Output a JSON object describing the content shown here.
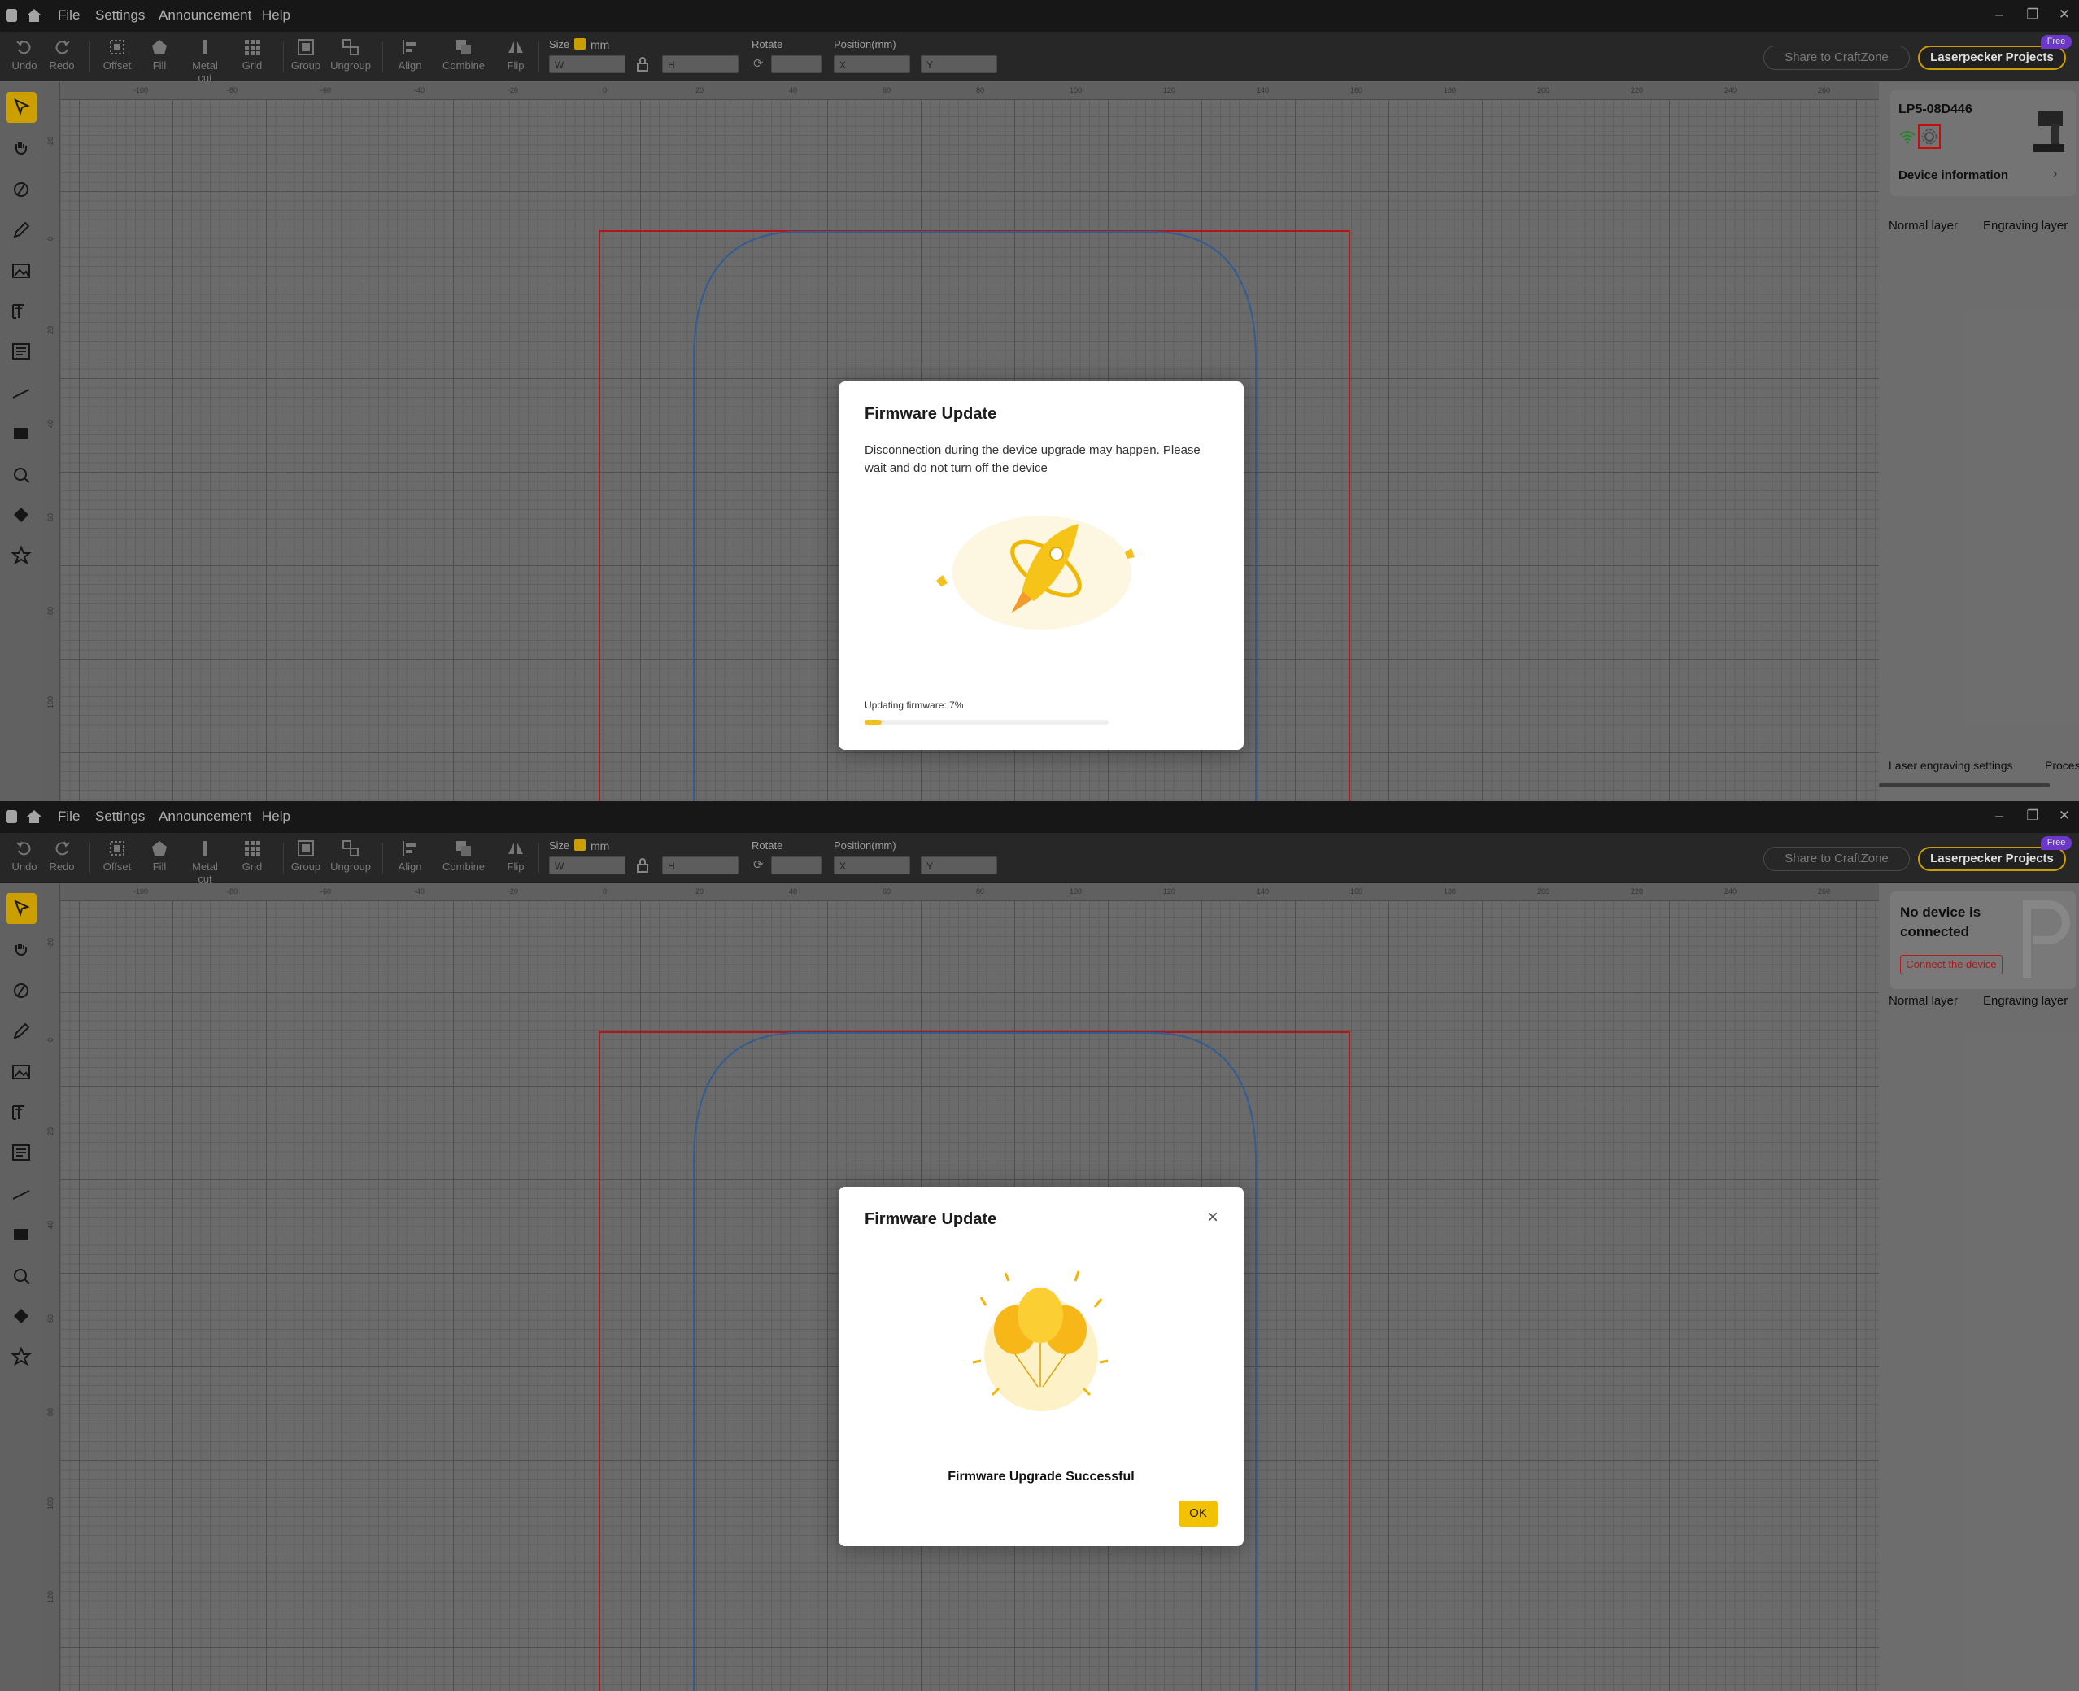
{
  "menubar": {
    "items": [
      "File",
      "Settings",
      "Announcement",
      "Help"
    ]
  },
  "toolbar": {
    "tools": [
      "Undo",
      "Redo",
      "Offset",
      "Fill",
      "Metal cut",
      "Grid",
      "Group",
      "Ungroup",
      "Align",
      "Combine",
      "Flip"
    ],
    "size_label": "Size",
    "unit": "mm",
    "w_placeholder": "W",
    "h_placeholder": "H",
    "rotate_label": "Rotate",
    "position_label": "Position(mm)",
    "x_placeholder": "X",
    "y_placeholder": "Y",
    "share_label": "Share to CraftZone",
    "projects_label": "Laserpecker Projects",
    "free_badge": "Free"
  },
  "ruler": {
    "x_ticks": [
      "-100",
      "-80",
      "-60",
      "-40",
      "-20",
      "0",
      "20",
      "40",
      "60",
      "80",
      "100",
      "120",
      "140",
      "160",
      "180",
      "200",
      "220",
      "240",
      "260"
    ],
    "y_ticks_top": [
      "-20",
      "0",
      "20",
      "40",
      "60",
      "80",
      "100"
    ],
    "y_ticks_bottom": [
      "-20",
      "0",
      "20",
      "40",
      "60",
      "80",
      "100",
      "120"
    ]
  },
  "top_pane": {
    "device": {
      "name": "LP5-08D446",
      "info_label": "Device information"
    },
    "layer_tabs": [
      "Normal layer",
      "Engraving layer"
    ],
    "bottom_tabs": [
      "Laser engraving settings",
      "Proces"
    ],
    "modal": {
      "title": "Firmware Update",
      "message": "Disconnection during the device upgrade may happen. Please wait and do not turn off the device",
      "progress_label": "Updating firmware: 7%",
      "progress_fraction": 0.07
    }
  },
  "bottom_pane": {
    "device": {
      "title": "No device is connected",
      "connect_label": "Connect the device"
    },
    "layer_tabs": [
      "Normal layer",
      "Engraving layer"
    ],
    "modal": {
      "title": "Firmware Update",
      "success_text": "Firmware Upgrade Successful",
      "ok_label": "OK",
      "close_icon": "close-icon"
    }
  },
  "colors": {
    "accent": "#f2c100",
    "outline_red": "#cc1a1a",
    "path_blue": "#3a6aa8",
    "free_badge": "#7c3fe6"
  }
}
